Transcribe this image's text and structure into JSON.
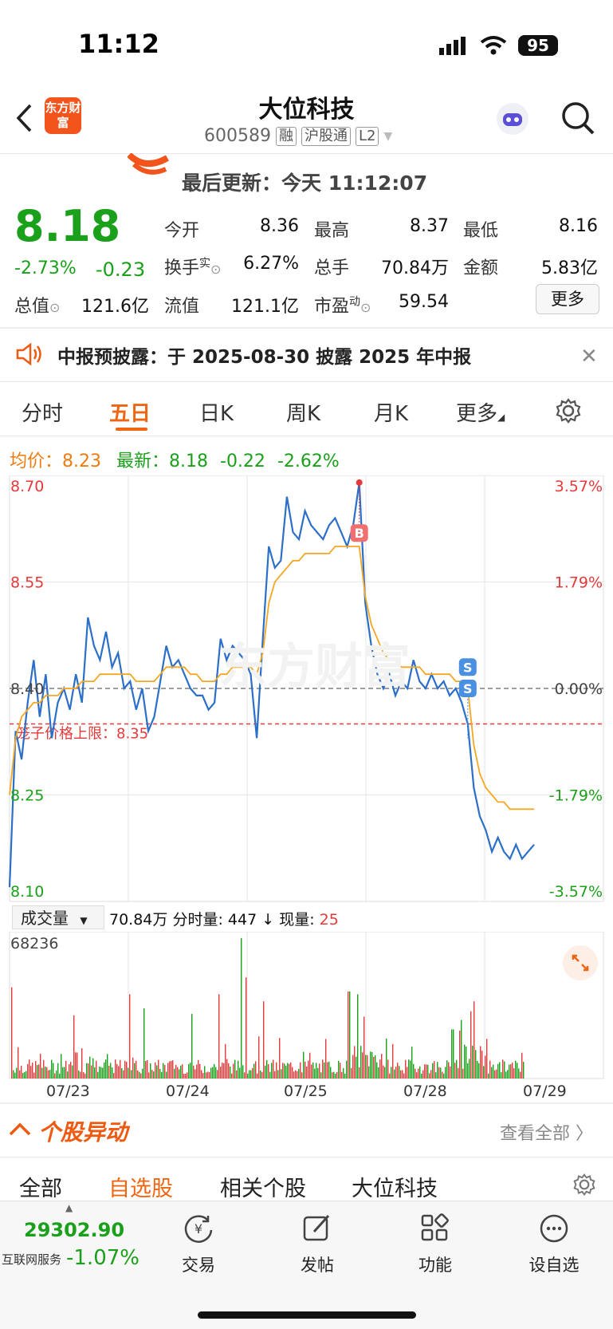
{
  "status_bar": {
    "time": "11:12",
    "battery": "95"
  },
  "header": {
    "logo_text": "东方财富",
    "title": "大位科技",
    "code": "600589",
    "tags": [
      "融",
      "沪股通",
      "L2"
    ]
  },
  "update": {
    "label": "最后更新：",
    "value": "今天 11:12:07"
  },
  "quote": {
    "price": "8.18",
    "change_pct": "-2.73%",
    "change": "-0.23",
    "open_label": "今开",
    "open": "8.36",
    "high_label": "最高",
    "high": "8.37",
    "low_label": "最低",
    "low": "8.16",
    "turnover_label": "换手",
    "turnover_sup": "实",
    "turnover": "6.27%",
    "volume_label": "总手",
    "volume": "70.84万",
    "amount_label": "金额",
    "amount": "5.83亿",
    "mktcap_label": "总值",
    "mktcap": "121.6亿",
    "float_label": "流值",
    "float": "121.1亿",
    "pe_label": "市盈",
    "pe_sup": "动",
    "pe": "59.54",
    "more_label": "更多"
  },
  "banner": {
    "text": "中报预披露：于 2025-08-30 披露 2025 年中报"
  },
  "chart_tabs": [
    "分时",
    "五日",
    "日K",
    "周K",
    "月K",
    "更多"
  ],
  "chart_info": {
    "avg_label": "均价：",
    "avg": "8.23",
    "latest_label": "最新：",
    "latest": "8.18",
    "latest_change": "-0.22",
    "latest_pct": "-2.62%"
  },
  "chart_data": {
    "type": "line",
    "title": "",
    "ylim": [
      8.1,
      8.7
    ],
    "y_ticks_left": [
      "8.70",
      "8.55",
      "8.40",
      "8.25",
      "8.10"
    ],
    "y_ticks_right": [
      "3.57%",
      "1.79%",
      "0.00%",
      "-1.79%",
      "-3.57%"
    ],
    "baseline": 8.4,
    "limit_line": {
      "label": "笼子价格上限：8.35",
      "value": 8.35
    },
    "x_labels": [
      "07/23",
      "07/24",
      "07/25",
      "07/28",
      "07/29"
    ],
    "series": [
      {
        "color": "#2b6fc8",
        "values": [
          8.12,
          8.34,
          8.3,
          8.38,
          8.44,
          8.36,
          8.42,
          8.33,
          8.38,
          8.4,
          8.37,
          8.42,
          8.38,
          8.5,
          8.46,
          8.44,
          8.48,
          8.43,
          8.45,
          8.4,
          8.41,
          8.37,
          8.4,
          8.34,
          8.36,
          8.41,
          8.46,
          8.43,
          8.44,
          8.42,
          8.4,
          8.39,
          8.39,
          8.37,
          8.38,
          8.47,
          8.44,
          8.46,
          8.45,
          8.44,
          8.42,
          8.33,
          8.47,
          8.6,
          8.57,
          8.58,
          8.67,
          8.62,
          8.61,
          8.65,
          8.63,
          8.62,
          8.61,
          8.63,
          8.64,
          8.62,
          8.6,
          8.63,
          8.69,
          8.52,
          8.46,
          8.42,
          8.4,
          8.42,
          8.39,
          8.41,
          8.4,
          8.44,
          8.41,
          8.4,
          8.42,
          8.4,
          8.41,
          8.39,
          8.4,
          8.38,
          8.35,
          8.26,
          8.22,
          8.2,
          8.17,
          8.19,
          8.17,
          8.16,
          8.18,
          8.16,
          8.17,
          8.18
        ]
      },
      {
        "color": "#f5a623",
        "values": [
          8.25,
          8.33,
          8.36,
          8.37,
          8.38,
          8.38,
          8.39,
          8.39,
          8.39,
          8.4,
          8.4,
          8.4,
          8.41,
          8.41,
          8.41,
          8.42,
          8.42,
          8.42,
          8.42,
          8.42,
          8.42,
          8.41,
          8.41,
          8.41,
          8.41,
          8.42,
          8.43,
          8.43,
          8.43,
          8.43,
          8.42,
          8.42,
          8.41,
          8.41,
          8.41,
          8.42,
          8.42,
          8.43,
          8.43,
          8.43,
          8.43,
          8.42,
          8.45,
          8.52,
          8.55,
          8.56,
          8.57,
          8.58,
          8.58,
          8.59,
          8.59,
          8.59,
          8.59,
          8.59,
          8.6,
          8.6,
          8.6,
          8.6,
          8.6,
          8.53,
          8.49,
          8.47,
          8.45,
          8.44,
          8.44,
          8.43,
          8.43,
          8.43,
          8.43,
          8.42,
          8.42,
          8.42,
          8.42,
          8.42,
          8.41,
          8.41,
          8.4,
          8.32,
          8.28,
          8.26,
          8.25,
          8.24,
          8.24,
          8.23,
          8.23,
          8.23,
          8.23,
          8.23
        ]
      }
    ],
    "markers": [
      {
        "label": "B"
      },
      {
        "label": "S"
      },
      {
        "label": "S"
      }
    ],
    "grid": true
  },
  "volume": {
    "selector": "成交量",
    "summary_total": "70.84万",
    "summary_label": "分时量:",
    "summary_value": "447",
    "summary_arrow": "↓",
    "now_label": "现量:",
    "now_value": "25",
    "max_label": "68236"
  },
  "section": {
    "title": "个股异动",
    "view_all": "查看全部"
  },
  "lower_tabs": [
    "全部",
    "自选股",
    "相关个股",
    "大位科技"
  ],
  "tabbar": {
    "index_value": "29302.90",
    "index_name": "互联网服务",
    "index_pct": "-1.07%",
    "items": [
      {
        "label": "交易",
        "icon": "yen-cycle-icon"
      },
      {
        "label": "发帖",
        "icon": "edit-icon"
      },
      {
        "label": "功能",
        "icon": "grid-icon"
      },
      {
        "label": "设自选",
        "icon": "more-dots-icon"
      }
    ]
  },
  "colors": {
    "accent": "#ee6612",
    "up": "#e53a3a",
    "down": "#1aa01a",
    "price_line": "#2b6fc8",
    "avg_line": "#f5a623"
  }
}
